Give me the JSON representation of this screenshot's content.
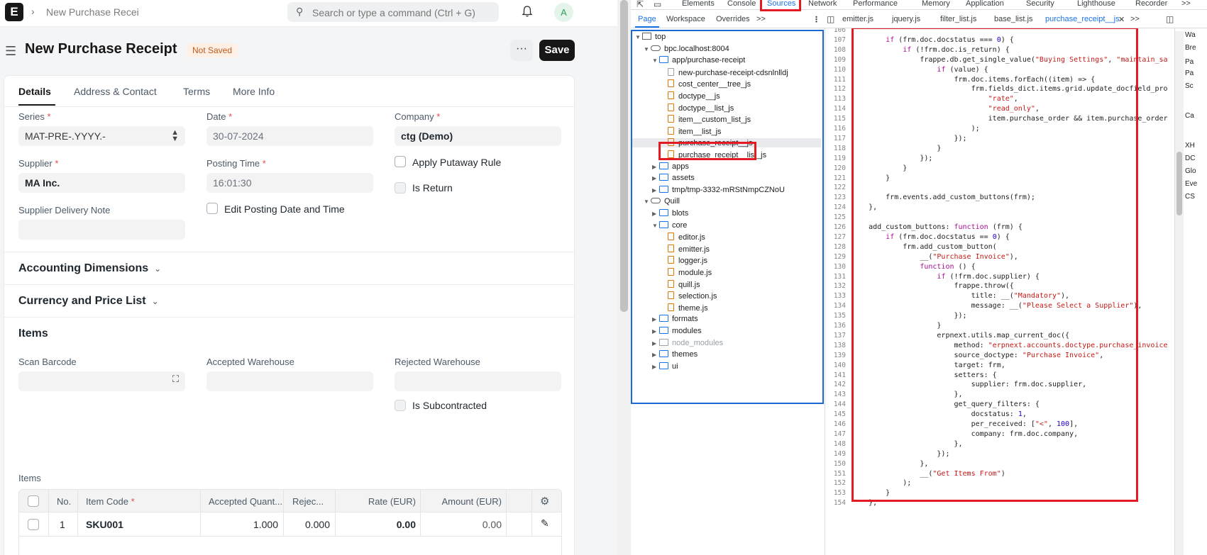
{
  "app": {
    "logo_letter": "E",
    "breadcrumb": "New Purchase Recei",
    "search_placeholder": "Search or type a command (Ctrl + G)",
    "avatar_letter": "A",
    "title": "New Purchase Receipt",
    "status_badge": "Not Saved",
    "more_label": "···",
    "save_label": "Save",
    "tabs": [
      {
        "label": "Details",
        "active": true
      },
      {
        "label": "Address & Contact",
        "active": false
      },
      {
        "label": "Terms",
        "active": false
      },
      {
        "label": "More Info",
        "active": false
      }
    ],
    "fields": {
      "series_label": "Series",
      "series_value": "MAT-PRE-.YYYY.-",
      "date_label": "Date",
      "date_value": "30-07-2024",
      "company_label": "Company",
      "company_value": "ctg (Demo)",
      "supplier_label": "Supplier",
      "supplier_value": "MA Inc.",
      "posting_time_label": "Posting Time",
      "posting_time_value": "16:01:30",
      "apply_putaway_label": "Apply Putaway Rule",
      "is_return_label": "Is Return",
      "supplier_delivery_note_label": "Supplier Delivery Note",
      "edit_posting_label": "Edit Posting Date and Time"
    },
    "sections": {
      "accounting": "Accounting Dimensions",
      "currency": "Currency and Price List",
      "items": "Items"
    },
    "items_section": {
      "scan_barcode_label": "Scan Barcode",
      "accepted_wh_label": "Accepted Warehouse",
      "rejected_wh_label": "Rejected Warehouse",
      "is_subcontracted_label": "Is Subcontracted",
      "table_label": "Items",
      "columns": [
        "No.",
        "Item Code",
        "Accepted Quant...",
        "Rejec...",
        "Rate (EUR)",
        "Amount (EUR)"
      ],
      "row": {
        "no": "1",
        "item_code": "SKU001",
        "accepted_qty": "1.000",
        "rejected_qty": "0.000",
        "rate": "0.00",
        "amount": "0.00"
      }
    }
  },
  "devtools": {
    "top_tabs": [
      "Elements",
      "Console",
      "Sources",
      "Network",
      "Performance",
      "Memory",
      "Application",
      "Security",
      "Lighthouse",
      "Recorder",
      ">>"
    ],
    "selected_top_tab": "Sources",
    "sub_tabs": [
      "Page",
      "Workspace",
      "Overrides",
      ">>"
    ],
    "file_tabs": [
      "emitter.js",
      "jquery.js",
      "filter_list.js",
      "base_list.js",
      "purchase_receipt__js",
      ">>"
    ],
    "tree": [
      {
        "label": "top",
        "kind": "frame",
        "depth": 0,
        "open": true
      },
      {
        "label": "bpc.localhost:8004",
        "kind": "cloud",
        "depth": 1,
        "open": true
      },
      {
        "label": "app/purchase-receipt",
        "kind": "folder",
        "depth": 2,
        "open": true
      },
      {
        "label": "new-purchase-receipt-cdsnlnlldj",
        "kind": "doc",
        "depth": 3
      },
      {
        "label": "cost_center__tree_js",
        "kind": "file",
        "depth": 3
      },
      {
        "label": "doctype__js",
        "kind": "file",
        "depth": 3
      },
      {
        "label": "doctype__list_js",
        "kind": "file",
        "depth": 3
      },
      {
        "label": "item__custom_list_js",
        "kind": "file",
        "depth": 3
      },
      {
        "label": "item__list_js",
        "kind": "file",
        "depth": 3
      },
      {
        "label": "purchase_receipt__js",
        "kind": "file",
        "depth": 3,
        "selected": true
      },
      {
        "label": "purchase_receipt__list_js",
        "kind": "file",
        "depth": 3
      },
      {
        "label": "apps",
        "kind": "folder",
        "depth": 2
      },
      {
        "label": "assets",
        "kind": "folder",
        "depth": 2
      },
      {
        "label": "tmp/tmp-3332-mRStNmpCZNoU",
        "kind": "folder",
        "depth": 2
      },
      {
        "label": "Quill",
        "kind": "cloud",
        "depth": 1,
        "open": true
      },
      {
        "label": "blots",
        "kind": "folder",
        "depth": 2
      },
      {
        "label": "core",
        "kind": "folder",
        "depth": 2,
        "open": true
      },
      {
        "label": "editor.js",
        "kind": "file",
        "depth": 3
      },
      {
        "label": "emitter.js",
        "kind": "file",
        "depth": 3
      },
      {
        "label": "logger.js",
        "kind": "file",
        "depth": 3
      },
      {
        "label": "module.js",
        "kind": "file",
        "depth": 3
      },
      {
        "label": "quill.js",
        "kind": "file",
        "depth": 3
      },
      {
        "label": "selection.js",
        "kind": "file",
        "depth": 3
      },
      {
        "label": "theme.js",
        "kind": "file",
        "depth": 3
      },
      {
        "label": "formats",
        "kind": "folder",
        "depth": 2
      },
      {
        "label": "modules",
        "kind": "folder",
        "depth": 2
      },
      {
        "label": "node_modules",
        "kind": "folder-muted",
        "depth": 2
      },
      {
        "label": "themes",
        "kind": "folder",
        "depth": 2
      },
      {
        "label": "ui",
        "kind": "folder",
        "depth": 2
      }
    ],
    "code_lines": [
      {
        "n": "106",
        "html": ""
      },
      {
        "n": "107",
        "html": "        <span class='kw'>if</span> (frm.doc.docstatus === <span class='num'>0</span>) {"
      },
      {
        "n": "108",
        "html": "            <span class='kw'>if</span> (!frm.doc.is_return) {"
      },
      {
        "n": "109",
        "html": "                frappe.db.get_single_value(<span class='str'>\"Buying Settings\"</span>, <span class='str'>\"maintain_sa</span>"
      },
      {
        "n": "110",
        "html": "                    <span class='kw'>if</span> (value) {"
      },
      {
        "n": "111",
        "html": "                        frm.doc.items.forEach((item) => {"
      },
      {
        "n": "112",
        "html": "                            frm.fields_dict.items.grid.update_docfield_pro"
      },
      {
        "n": "113",
        "html": "                                <span class='str'>\"rate\"</span>,"
      },
      {
        "n": "114",
        "html": "                                <span class='str'>\"read_only\"</span>,"
      },
      {
        "n": "115",
        "html": "                                item.purchase_order &amp;&amp; item.purchase_order"
      },
      {
        "n": "116",
        "html": "                            );"
      },
      {
        "n": "117",
        "html": "                        });"
      },
      {
        "n": "118",
        "html": "                    }"
      },
      {
        "n": "119",
        "html": "                });"
      },
      {
        "n": "120",
        "html": "            }"
      },
      {
        "n": "121",
        "html": "        }"
      },
      {
        "n": "122",
        "html": ""
      },
      {
        "n": "123",
        "html": "        frm.events.add_custom_buttons(frm);"
      },
      {
        "n": "124",
        "html": "    },"
      },
      {
        "n": "125",
        "html": ""
      },
      {
        "n": "126",
        "html": "    add_custom_buttons: <span class='kw'>function</span> (frm) {"
      },
      {
        "n": "127",
        "html": "        <span class='kw'>if</span> (frm.doc.docstatus == <span class='num'>0</span>) {"
      },
      {
        "n": "128",
        "html": "            frm.add_custom_button("
      },
      {
        "n": "129",
        "html": "                __(<span class='str'>\"Purchase Invoice\"</span>),"
      },
      {
        "n": "130",
        "html": "                <span class='kw'>function</span> () {"
      },
      {
        "n": "131",
        "html": "                    <span class='kw'>if</span> (!frm.doc.supplier) {"
      },
      {
        "n": "132",
        "html": "                        frappe.throw({"
      },
      {
        "n": "133",
        "html": "                            title: __(<span class='str'>\"Mandatory\"</span>),"
      },
      {
        "n": "134",
        "html": "                            message: __(<span class='str'>\"Please Select a Supplier\"</span>),"
      },
      {
        "n": "135",
        "html": "                        });"
      },
      {
        "n": "136",
        "html": "                    }"
      },
      {
        "n": "137",
        "html": "                    erpnext.utils.map_current_doc({"
      },
      {
        "n": "138",
        "html": "                        method: <span class='str'>\"erpnext.accounts.doctype.purchase_invoice</span>"
      },
      {
        "n": "139",
        "html": "                        source_doctype: <span class='str'>\"Purchase Invoice\"</span>,"
      },
      {
        "n": "140",
        "html": "                        target: frm,"
      },
      {
        "n": "141",
        "html": "                        setters: {"
      },
      {
        "n": "142",
        "html": "                            supplier: frm.doc.supplier,"
      },
      {
        "n": "143",
        "html": "                        },"
      },
      {
        "n": "144",
        "html": "                        get_query_filters: {"
      },
      {
        "n": "145",
        "html": "                            docstatus: <span class='num'>1</span>,"
      },
      {
        "n": "146",
        "html": "                            per_received: [<span class='str'>\"&lt;\"</span>, <span class='num'>100</span>],"
      },
      {
        "n": "147",
        "html": "                            company: frm.doc.company,"
      },
      {
        "n": "148",
        "html": "                        },"
      },
      {
        "n": "149",
        "html": "                    });"
      },
      {
        "n": "150",
        "html": "                },"
      },
      {
        "n": "151",
        "html": "                __(<span class='str'>\"Get Items From\"</span>)"
      },
      {
        "n": "152",
        "html": "            );"
      },
      {
        "n": "153",
        "html": "        }"
      },
      {
        "n": "154",
        "html": "    },"
      }
    ],
    "right_panel": [
      "Wa",
      "Bre",
      "Pa",
      "Pa",
      "Sc",
      "Ca",
      "XH",
      "DC",
      "Glo",
      "Eve",
      "CS"
    ]
  }
}
